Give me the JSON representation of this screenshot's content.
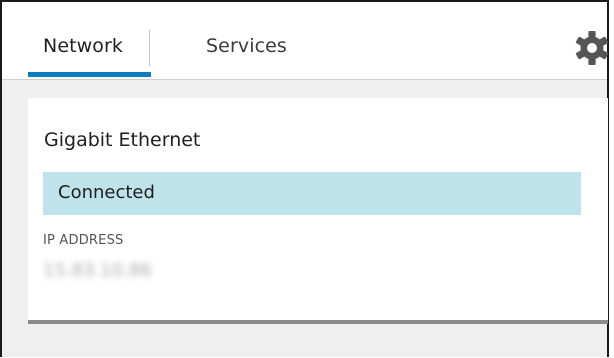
{
  "tabs": {
    "network_label": "Network",
    "services_label": "Services"
  },
  "settings_icon": "gear-icon",
  "card": {
    "title": "Gigabit Ethernet",
    "status": "Connected",
    "ip_label": "IP ADDRESS",
    "ip_value": "15.83.10.86"
  },
  "colors": {
    "accent": "#0a7fbf",
    "status_bg": "#bfe3ea"
  }
}
